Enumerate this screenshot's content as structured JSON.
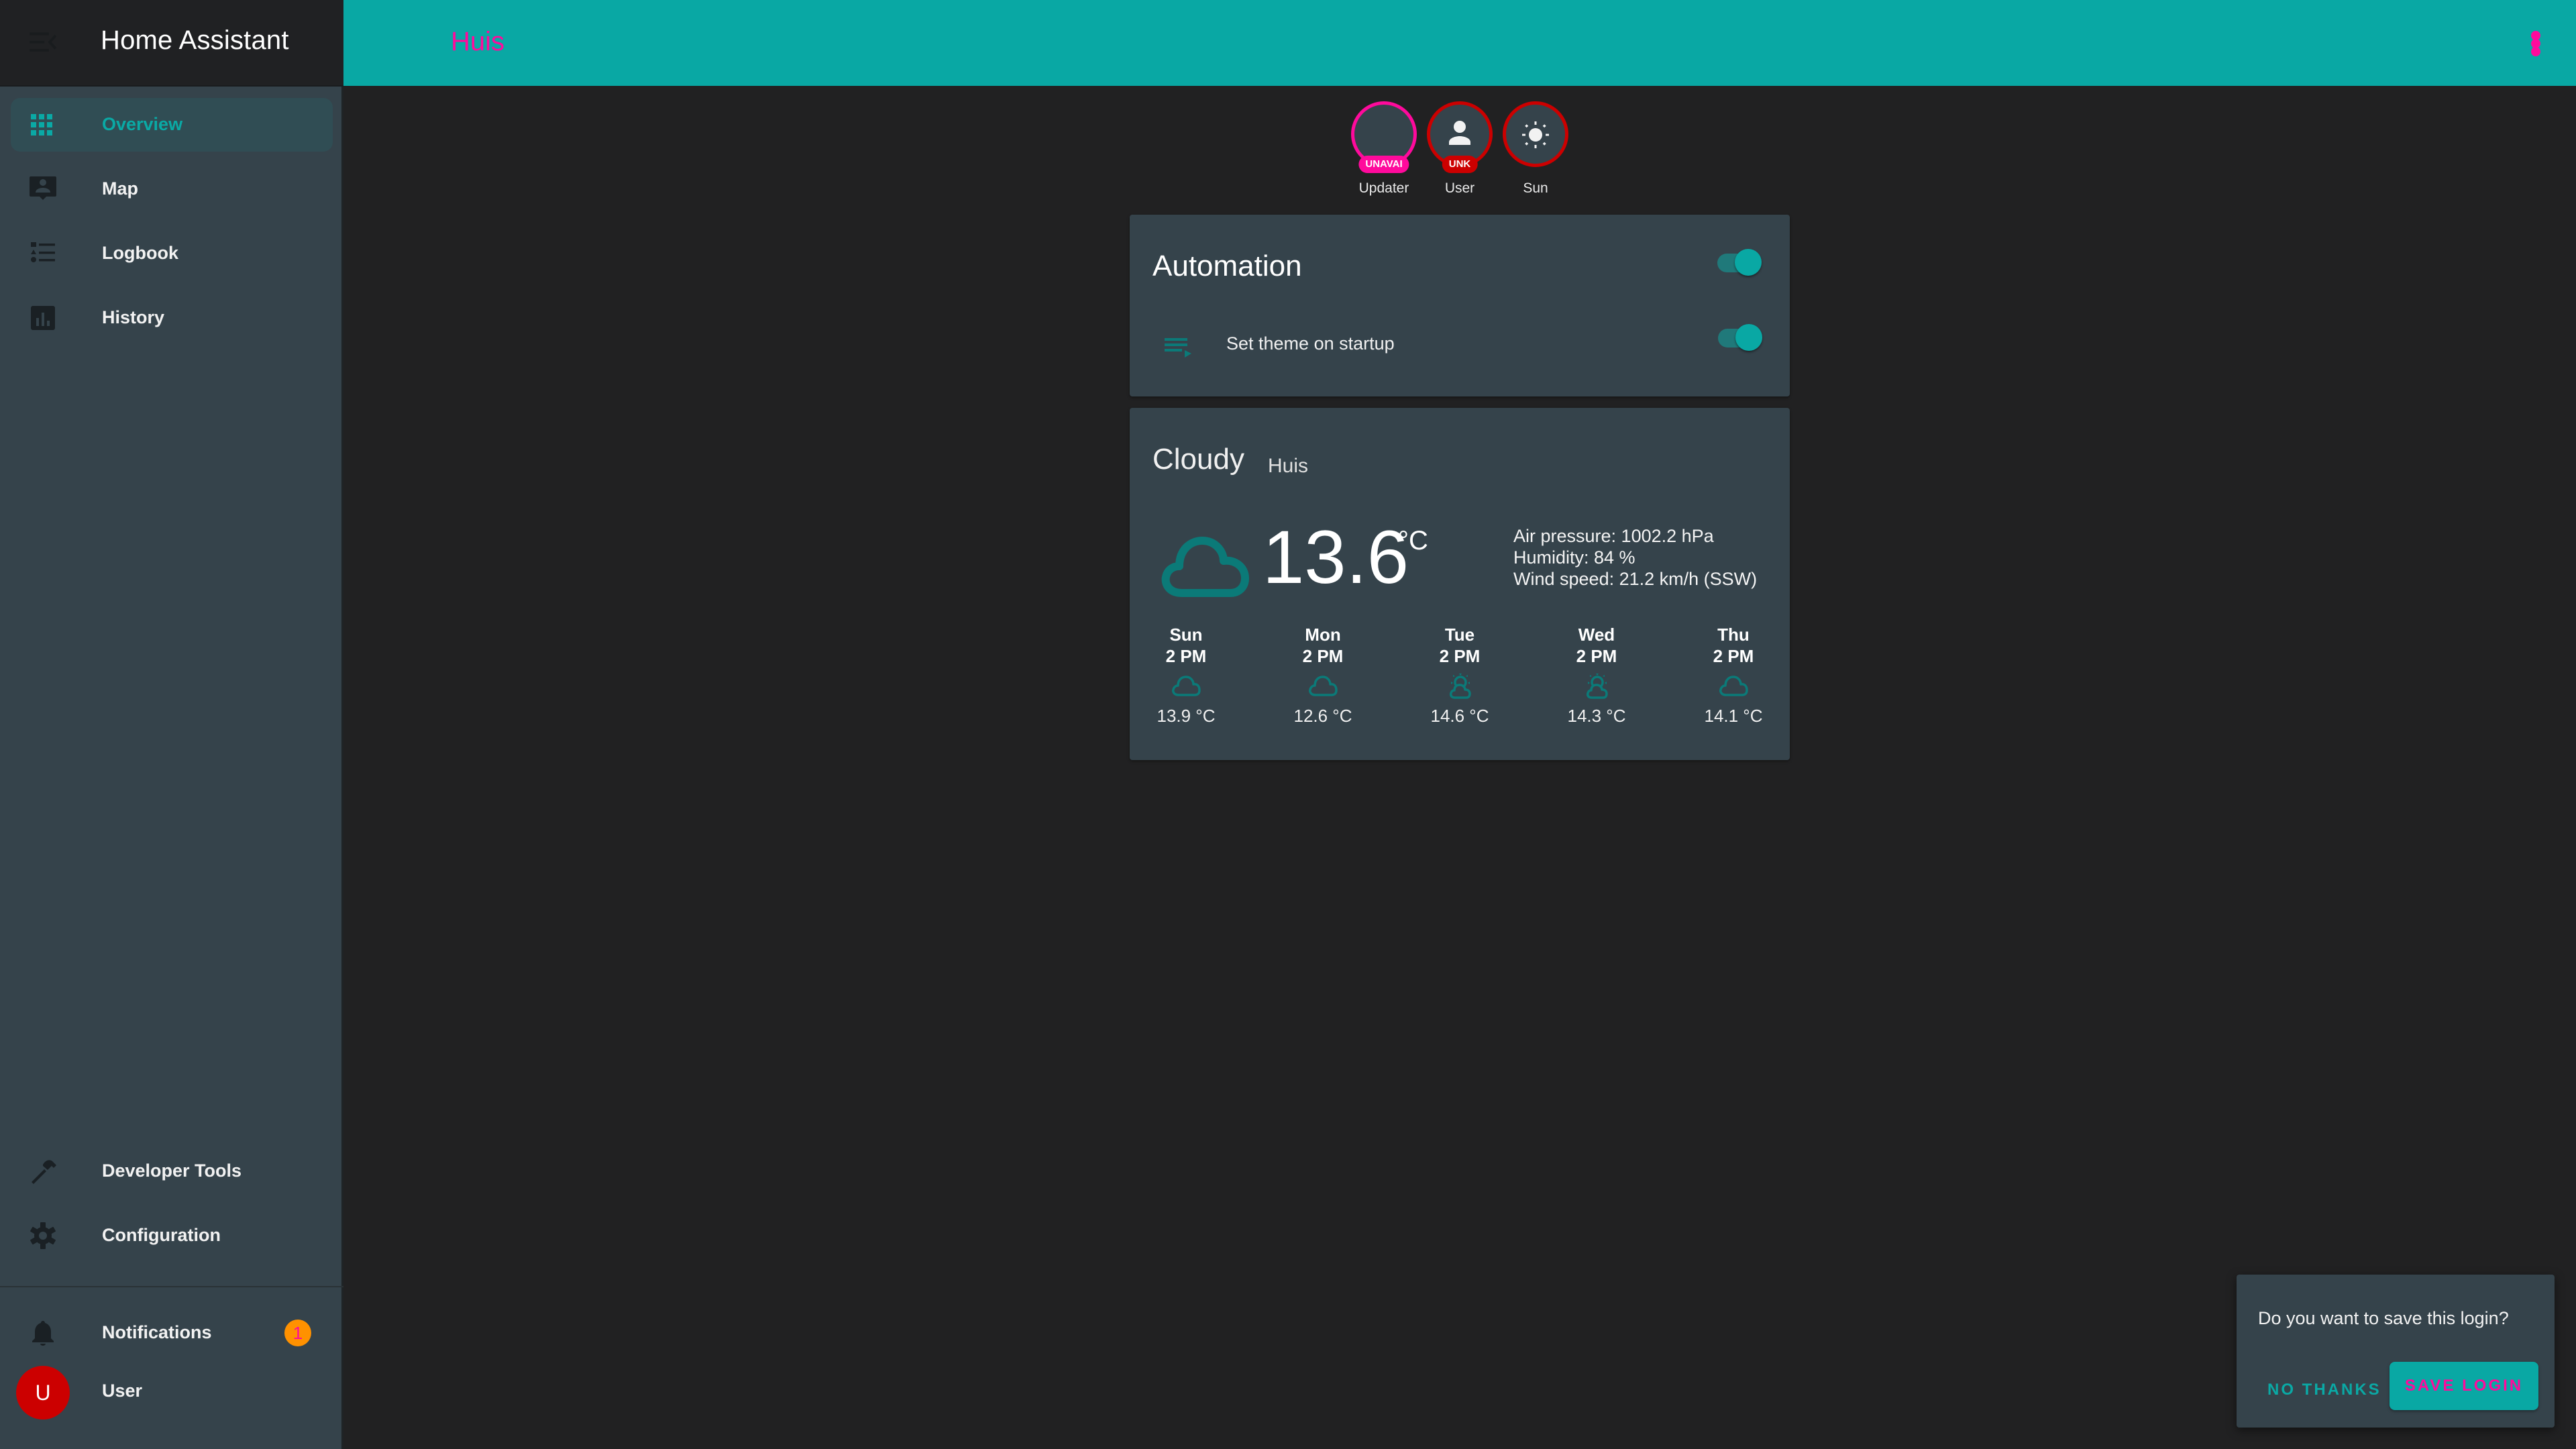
{
  "app": {
    "title": "Home Assistant"
  },
  "colors": {
    "primary": "#09a8a4",
    "accent": "#ff0a9c",
    "error": "#cc0000",
    "warning": "#ff9100",
    "card_bg": "#35434b",
    "page_bg": "#212122"
  },
  "sidebar": {
    "menu_icon": "menu-open-icon",
    "items": [
      {
        "label": "Overview",
        "icon": "view-dashboard-icon",
        "active": true
      },
      {
        "label": "Map",
        "icon": "account-location-icon"
      },
      {
        "label": "Logbook",
        "icon": "format-list-bulleted-type-icon"
      },
      {
        "label": "History",
        "icon": "chart-box-icon"
      }
    ],
    "bottom_items": [
      {
        "label": "Developer Tools",
        "icon": "hammer-icon"
      },
      {
        "label": "Configuration",
        "icon": "cog-icon"
      }
    ],
    "notifications": {
      "label": "Notifications",
      "icon": "bell-icon",
      "count": "1"
    },
    "user": {
      "label": "User",
      "initial": "U"
    }
  },
  "header": {
    "title": "Huis",
    "menu_icon": "dots-vertical-icon"
  },
  "badges": [
    {
      "name": "Updater",
      "state": "UNAVAI",
      "icon": "none"
    },
    {
      "name": "User",
      "state": "UNK",
      "icon": "account-icon"
    },
    {
      "name": "Sun",
      "state": "",
      "icon": "sun-icon"
    }
  ],
  "automation_card": {
    "title": "Automation",
    "header_toggle_on": true,
    "rows": [
      {
        "name": "Set theme on startup",
        "icon": "playlist-play-icon",
        "on": true
      }
    ]
  },
  "weather_card": {
    "state": "Cloudy",
    "name": "Huis",
    "temperature": "13.6",
    "unit": "°C",
    "attributes": [
      "Air pressure: 1002.2 hPa",
      "Humidity: 84 %",
      "Wind speed: 21.2 km/h (SSW)"
    ],
    "forecast": [
      {
        "day": "Sun",
        "time": "2 PM",
        "condition": "cloudy",
        "temp": "13.9 °C"
      },
      {
        "day": "Mon",
        "time": "2 PM",
        "condition": "cloudy",
        "temp": "12.6 °C"
      },
      {
        "day": "Tue",
        "time": "2 PM",
        "condition": "partlycloudy",
        "temp": "14.6 °C"
      },
      {
        "day": "Wed",
        "time": "2 PM",
        "condition": "partlycloudy",
        "temp": "14.3 °C"
      },
      {
        "day": "Thu",
        "time": "2 PM",
        "condition": "cloudy",
        "temp": "14.1 °C"
      }
    ]
  },
  "toast": {
    "message": "Do you want to save this login?",
    "dismiss_label": "NO THANKS",
    "confirm_label": "SAVE LOGIN"
  }
}
